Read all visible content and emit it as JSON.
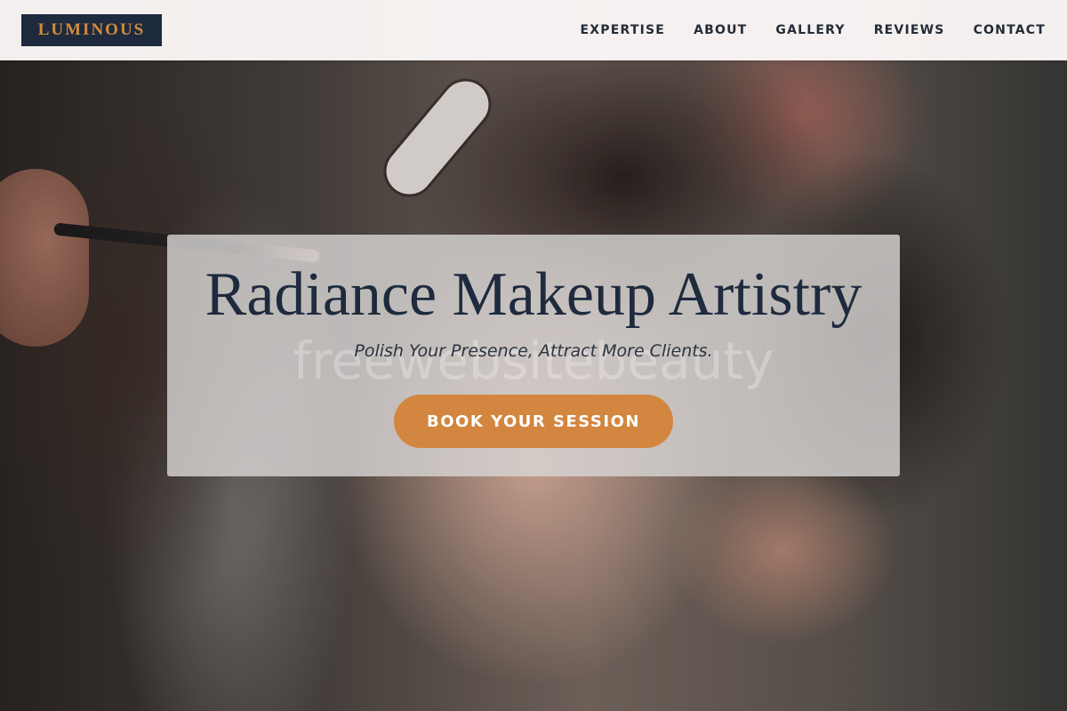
{
  "brand": {
    "logo_text": "LUMINOUS",
    "logo_bg": "#1e2a3d",
    "logo_color": "#d48b3e"
  },
  "nav": {
    "items": [
      {
        "label": "EXPERTISE"
      },
      {
        "label": "ABOUT"
      },
      {
        "label": "GALLERY"
      },
      {
        "label": "REVIEWS"
      },
      {
        "label": "CONTACT"
      }
    ]
  },
  "hero": {
    "title": "Radiance Makeup Artistry",
    "subtitle": "Polish Your Presence, Attract More Clients.",
    "watermark": "freewebsitebeauty",
    "cta_label": "BOOK YOUR SESSION",
    "cta_color": "#d2863f",
    "background_image": "makeup artist applying makeup to woman's face"
  }
}
